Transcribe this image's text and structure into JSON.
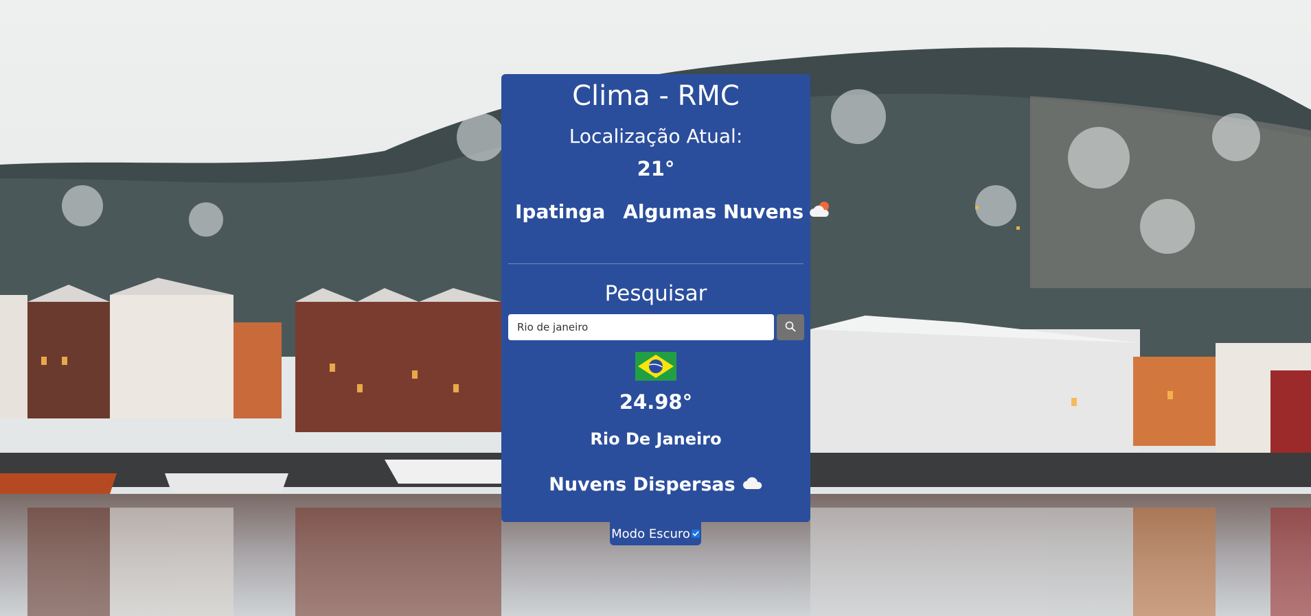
{
  "app": {
    "title": "Clima - RMC"
  },
  "current_location": {
    "label": "Localização Atual:",
    "temperature": "21°",
    "city": "Ipatinga",
    "description": "Algumas Nuvens",
    "icon": "partly-cloudy-icon"
  },
  "search": {
    "title": "Pesquisar",
    "input_value": "Rio de janeiro",
    "button_icon": "search-icon"
  },
  "result": {
    "flag_icon": "brazil-flag-icon",
    "temperature": "24.98°",
    "city": "Rio De Janeiro",
    "description": "Nuvens Dispersas",
    "icon": "cloud-icon"
  },
  "dark_mode": {
    "label": "Modo Escuro",
    "checked": true
  },
  "colors": {
    "card": "#2b4e9c",
    "search_button": "#727272",
    "checkbox": "#1a73e8"
  }
}
